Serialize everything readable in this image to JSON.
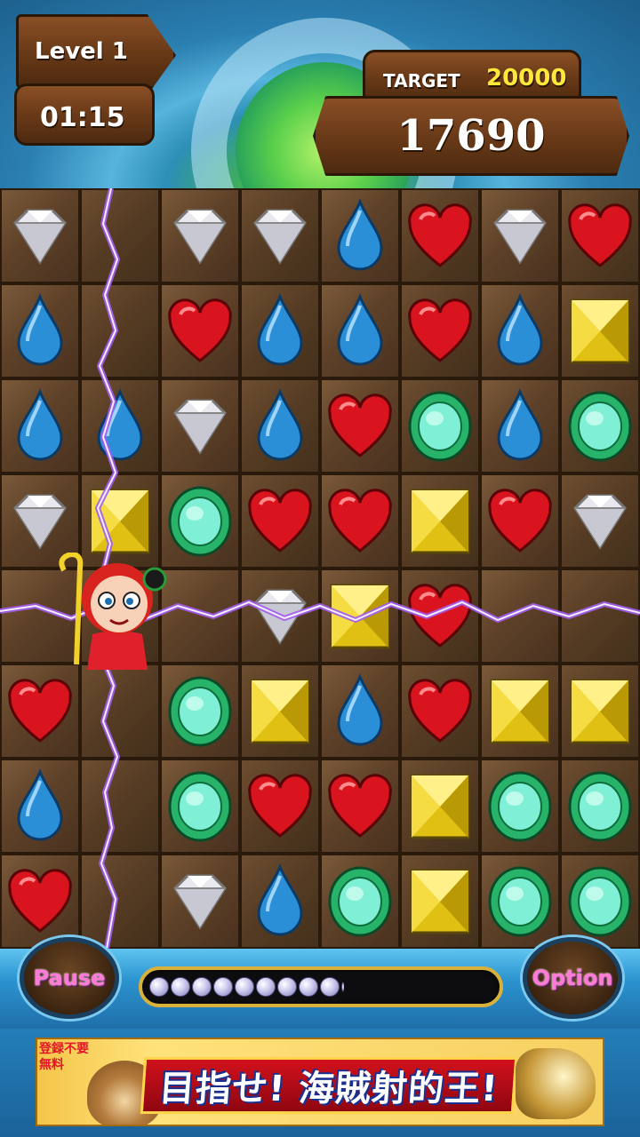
{
  "hud": {
    "level_label": "Level 1",
    "timer": "01:15",
    "target_label": "TARGET",
    "target_value": "20000",
    "score": "17690"
  },
  "board": {
    "columns": 8,
    "rows": 8,
    "grid": [
      [
        "diamond",
        "",
        "diamond",
        "diamond",
        "drop",
        "heart",
        "diamond",
        "heart"
      ],
      [
        "drop",
        "",
        "heart",
        "drop",
        "drop",
        "heart",
        "drop",
        "square"
      ],
      [
        "drop",
        "drop",
        "diamond",
        "drop",
        "heart",
        "ring",
        "drop",
        "ring"
      ],
      [
        "diamond",
        "square",
        "ring",
        "heart",
        "heart",
        "square",
        "heart",
        "diamond"
      ],
      [
        "",
        "",
        "",
        "diamond",
        "square",
        "heart",
        "",
        ""
      ],
      [
        "heart",
        "",
        "ring",
        "square",
        "drop",
        "heart",
        "square",
        "square"
      ],
      [
        "drop",
        "",
        "ring",
        "heart",
        "heart",
        "square",
        "ring",
        "ring"
      ],
      [
        "heart",
        "",
        "diamond",
        "drop",
        "ring",
        "square",
        "ring",
        "ring"
      ]
    ],
    "gem_colors": {
      "diamond": "#e8e8ee",
      "drop": "#2b8fd8",
      "heart": "#d9141e",
      "ring": "#27b36a",
      "square": "#e0c012"
    },
    "lightning_color": "#a35cf0"
  },
  "controls": {
    "pause_label": "Pause",
    "option_label": "Option",
    "progress_fraction": 0.56,
    "progress_gem_count": 11
  },
  "ad": {
    "corner_text": "登録不要 無料",
    "headline": "目指せ! 海賊射的王!"
  }
}
